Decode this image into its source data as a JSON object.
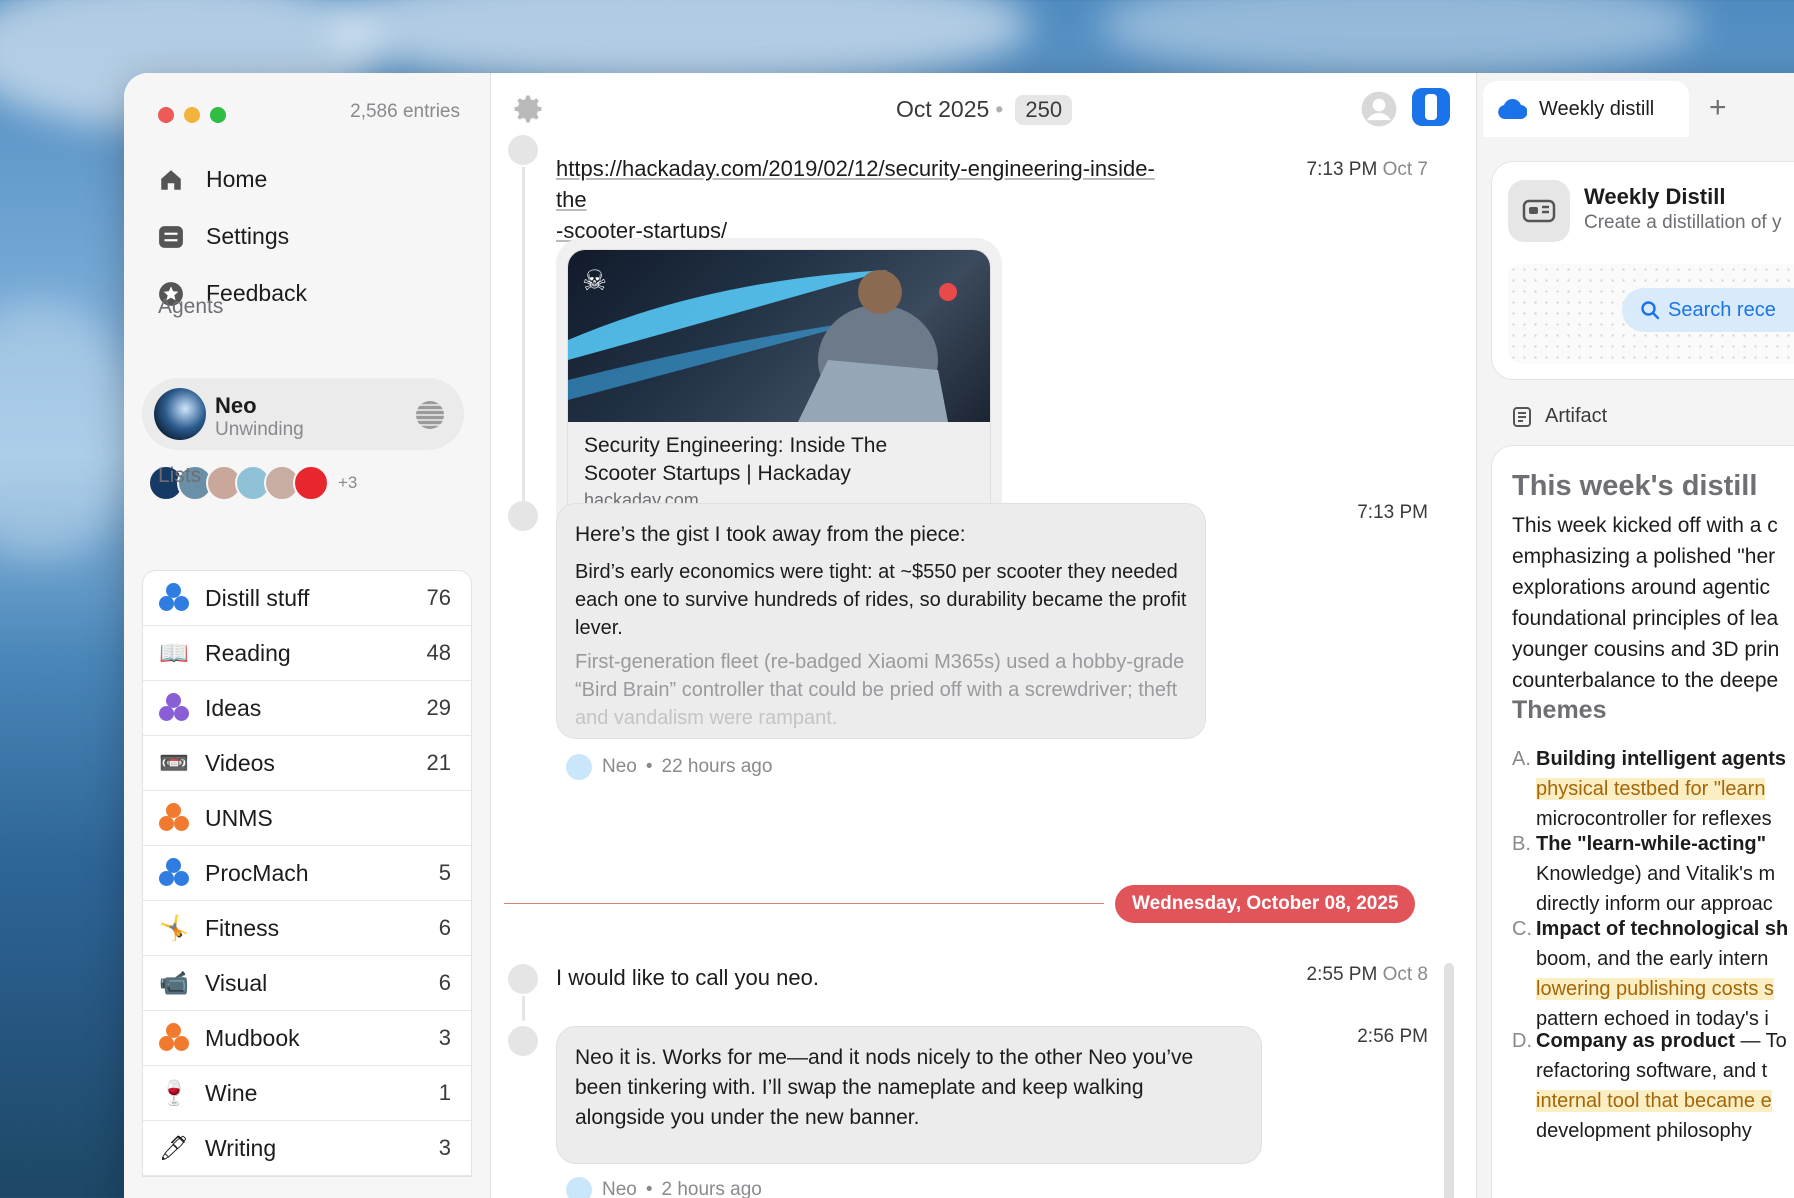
{
  "sidebar": {
    "entries": "2,586 entries",
    "nav": [
      {
        "label": "Home",
        "icon": "home-icon"
      },
      {
        "label": "Settings",
        "icon": "settings-icon"
      },
      {
        "label": "Feedback",
        "icon": "feedback-icon"
      }
    ],
    "agents_heading": "Agents",
    "agent": {
      "name": "Neo",
      "status": "Unwinding"
    },
    "more_agents": "+3",
    "lists_heading": "Lists",
    "lists": [
      {
        "label": "Distill stuff",
        "count": "76"
      },
      {
        "label": "Reading",
        "count": "48"
      },
      {
        "label": "Ideas",
        "count": "29"
      },
      {
        "label": "Videos",
        "count": "21"
      },
      {
        "label": "UNMS",
        "count": ""
      },
      {
        "label": "ProcMach",
        "count": "5"
      },
      {
        "label": "Fitness",
        "count": "6"
      },
      {
        "label": "Visual",
        "count": "6"
      },
      {
        "label": "Mudbook",
        "count": "3"
      },
      {
        "label": "Wine",
        "count": "1"
      },
      {
        "label": "Writing",
        "count": "3"
      }
    ]
  },
  "chat": {
    "title": "Oct 2025",
    "count": "250",
    "msg1": {
      "line1": "https://hackaday.com/2019/02/12/security-engineering-inside-the",
      "line2": "-scooter-startups/",
      "time": "7:13 PM",
      "date": "Oct 7"
    },
    "card": {
      "title_line1": "Security Engineering: Inside The",
      "title_line2": "Scooter Startups | Hackaday",
      "domain": "hackaday.com"
    },
    "reply1": {
      "time": "7:13 PM",
      "intro": "Here’s the gist I took away from the piece:",
      "p1": [
        "Bird’s early economics were tight: at ~$550 per scooter they needed",
        "each one to survive hundreds of rides, so durability became the profit",
        "lever."
      ],
      "p2": [
        "First-generation fleet (re-badged Xiaomi M365s) used a hobby-grade",
        "“Bird Brain” controller that could be pried off with a screwdriver; theft",
        "and vandalism were rampant."
      ],
      "author": "Neo",
      "ago": "22 hours ago"
    },
    "date_divider": "Wednesday, October 08, 2025",
    "msg2": {
      "text": "I would like to call you neo.",
      "time": "2:55 PM",
      "date": "Oct 8"
    },
    "reply2": {
      "time": "2:56 PM",
      "lines": [
        "Neo it is. Works for me—and it nods nicely to the other Neo you’ve",
        "been tinkering with. I’ll swap the nameplate and keep walking",
        "alongside you under the new banner."
      ],
      "author": "Neo",
      "ago": "2 hours ago"
    }
  },
  "right": {
    "tab": "Weekly distill",
    "wd_title": "Weekly Distill",
    "wd_sub": "Create a distillation of y",
    "search": "Search rece",
    "artifact": "Artifact",
    "doc_title": "This week's distill",
    "para": [
      "This week kicked off with a c",
      "emphasizing a polished \"her",
      "explorations around agentic",
      "foundational principles of lea",
      "younger cousins and 3D prin",
      "counterbalance to the deepe"
    ],
    "themes_heading": "Themes",
    "themes": [
      {
        "k": "A.",
        "l1": "Building intelligent agents",
        "l2": "physical testbed for \"learn",
        "l3": "microcontroller for reflexes"
      },
      {
        "k": "B.",
        "l1": "The \"learn-while-acting\"",
        "l2": "Knowledge) and Vitalik's m",
        "l3": "directly inform our approac"
      },
      {
        "k": "C.",
        "l1": "Impact of technological sh",
        "l2": "boom, and the early intern",
        "l3": "lowering publishing costs s",
        "l4": "pattern echoed in today's i"
      },
      {
        "k": "D.",
        "l1a": "Company as product",
        "l1b": " — To",
        "l2": "refactoring software, and t",
        "l3": "internal tool that became e",
        "l4": "development philosophy"
      }
    ]
  },
  "colors": {
    "accent": "#1a73e8",
    "date_pill": "#e0545a",
    "highlight": "#fbeec2"
  }
}
